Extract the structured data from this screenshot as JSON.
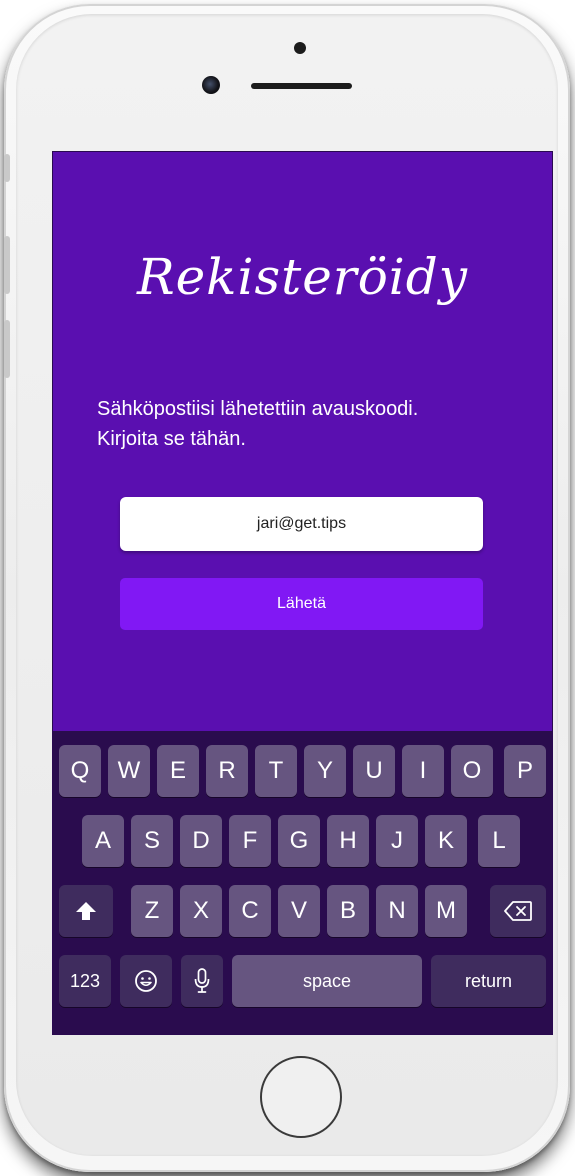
{
  "app": {
    "title": "Rekisteröidy",
    "instruction_line1": "Sähköpostiisi lähetettiin avauskoodi.",
    "instruction_line2": "Kirjoita se tähän.",
    "email_value": "jari@get.tips",
    "send_label": "Lähetä"
  },
  "keyboard": {
    "row1": [
      "Q",
      "W",
      "E",
      "R",
      "T",
      "Y",
      "U",
      "I",
      "O",
      "P"
    ],
    "row2": [
      "A",
      "S",
      "D",
      "F",
      "G",
      "H",
      "J",
      "K",
      "L"
    ],
    "row3": [
      "Z",
      "X",
      "C",
      "V",
      "B",
      "N",
      "M"
    ],
    "numbers_label": "123",
    "space_label": "space",
    "return_label": "return"
  },
  "icons": {
    "shift": "shift-icon",
    "backspace": "backspace-icon",
    "emoji": "emoji-icon",
    "microphone": "microphone-icon"
  },
  "colors": {
    "screen_background": "#5a0fb0",
    "send_button": "#8118f4",
    "keyboard_background": "#2a0c4e",
    "key": "#665580",
    "key_dark": "#3f2c5e"
  }
}
